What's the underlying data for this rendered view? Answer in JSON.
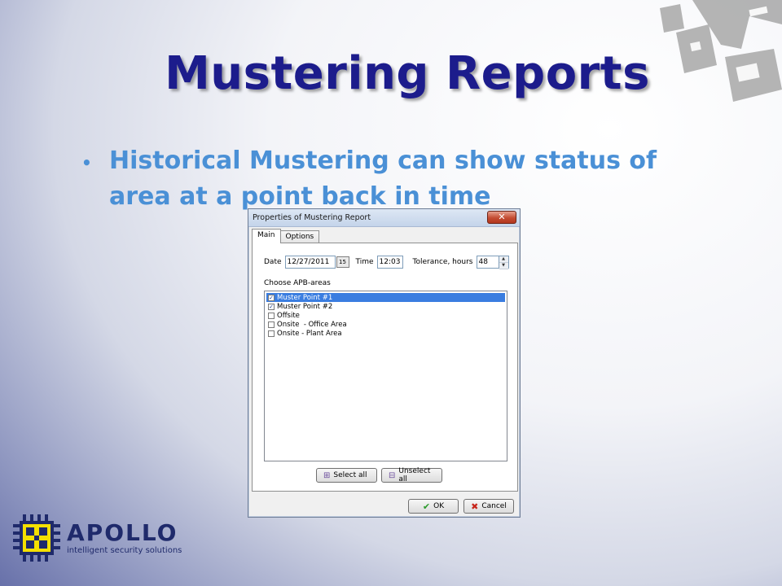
{
  "slide": {
    "title": "Mustering Reports",
    "bullet": "Historical Mustering can show status of area at a point back in time"
  },
  "dialog": {
    "title": "Properties of Mustering Report",
    "close_glyph": "✕",
    "tabs": [
      {
        "label": "Main",
        "active": true
      },
      {
        "label": "Options",
        "active": false
      }
    ],
    "date_label": "Date",
    "date_value": "12/27/2011",
    "calendar_glyph": "15",
    "time_label": "Time",
    "time_value": "12:03",
    "tolerance_label": "Tolerance, hours",
    "tolerance_value": "48",
    "choose_label": "Choose APB-areas",
    "areas": [
      {
        "label": "Muster Point #1",
        "checked": true,
        "selected": true
      },
      {
        "label": "Muster Point #2",
        "checked": true,
        "selected": false
      },
      {
        "label": "Offsite",
        "checked": false,
        "selected": false
      },
      {
        "label": "Onsite  - Office Area",
        "checked": false,
        "selected": false
      },
      {
        "label": "Onsite - Plant Area",
        "checked": false,
        "selected": false
      }
    ],
    "select_all_label": "Select all",
    "unselect_all_label": "Unselect all",
    "ok_label": "OK",
    "cancel_label": "Cancel"
  },
  "logo": {
    "name": "APOLLO",
    "tagline": "intelligent security solutions"
  },
  "colors": {
    "title": "#1c1c8c",
    "bullet": "#4a90d6",
    "selection": "#3a7de0",
    "logo_yellow": "#f5e000",
    "logo_navy": "#1f2a6b"
  }
}
